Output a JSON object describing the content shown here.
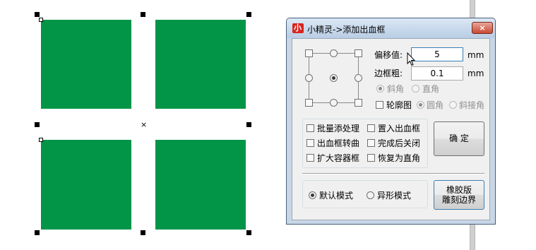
{
  "canvas": {
    "square_color": "#029548",
    "center_marker": "×"
  },
  "dialog": {
    "title": "小精灵->添加出血框",
    "close_icon": "×",
    "offset_label": "偏移值:",
    "offset_value": "5",
    "offset_unit": "mm",
    "border_label": "边框粗:",
    "border_value": "0.1",
    "border_unit": "mm",
    "bevel_label": "斜角",
    "right_angle_label": "直角",
    "outline_label": "轮廓图",
    "round_corner_label": "圆角",
    "miter_label": "斜接角",
    "batch_label": "批量添处理",
    "place_bleed_label": "置入出血框",
    "bleed_to_curve_label": "出血框转曲",
    "close_after_label": "完成后关闭",
    "expand_container_label": "扩大容器框",
    "restore_right_label": "恢复为直角",
    "ok_label": "确 定",
    "default_mode_label": "默认模式",
    "special_mode_label": "异形模式",
    "rubber_line1": "橡胶版",
    "rubber_line2": "雕刻边界"
  }
}
